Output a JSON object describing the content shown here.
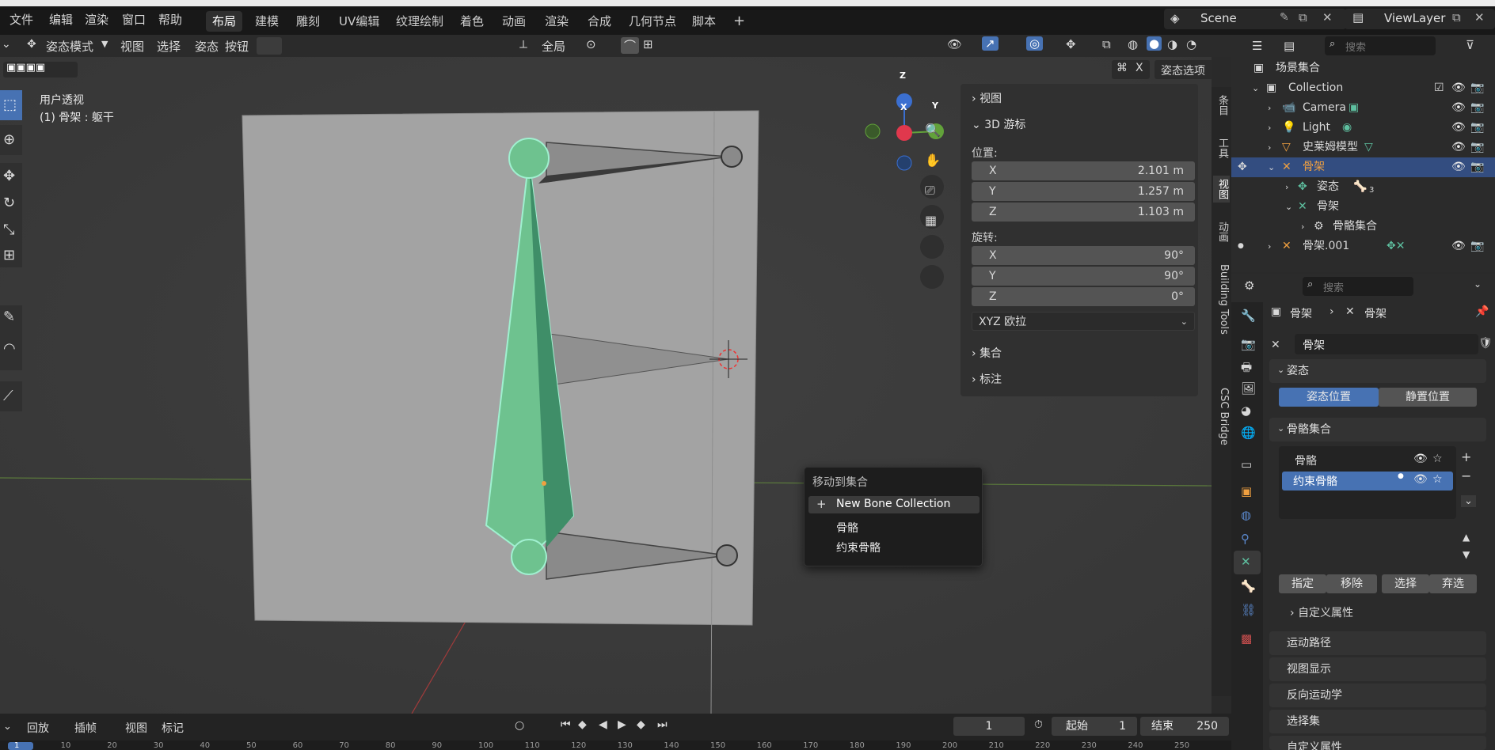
{
  "menubar": {
    "items": [
      "文件",
      "编辑",
      "渲染",
      "窗口",
      "帮助"
    ],
    "workspaces": [
      "布局",
      "建模",
      "雕刻",
      "UV编辑",
      "纹理绘制",
      "着色",
      "动画",
      "渲染",
      "合成",
      "几何节点",
      "脚本"
    ],
    "active_workspace": "布局",
    "add_tab": "+",
    "scene_name": "Scene",
    "viewlayer_name": "ViewLayer"
  },
  "viewport_header": {
    "mode": "姿态模式",
    "menus": [
      "视图",
      "选择",
      "姿态",
      "按钮"
    ],
    "transform_orientation": "全局",
    "pose_options": "姿态选项",
    "x_label": "X"
  },
  "viewport": {
    "view_name": "用户透视",
    "object_info": "(1) 骨架 : 躯干",
    "gizmo": {
      "x": "X",
      "y": "Y",
      "z": "Z"
    }
  },
  "npanel": {
    "view_section": "视图",
    "cursor_section": "3D 游标",
    "location_label": "位置:",
    "location": [
      {
        "axis": "X",
        "value": "2.101 m"
      },
      {
        "axis": "Y",
        "value": "1.257 m"
      },
      {
        "axis": "Z",
        "value": "1.103 m"
      }
    ],
    "rotation_label": "旋转:",
    "rotation": [
      {
        "axis": "X",
        "value": "90°"
      },
      {
        "axis": "Y",
        "value": "90°"
      },
      {
        "axis": "Z",
        "value": "0°"
      }
    ],
    "rotation_mode": "XYZ 欧拉",
    "collection_section": "集合",
    "annotation_section": "标注"
  },
  "sidebar_tabs": [
    "条目",
    "工具",
    "视图",
    "动画",
    "Building Tools",
    "CSC Bridge"
  ],
  "context_menu": {
    "title": "移动到集合",
    "new_item": "New Bone Collection",
    "items": [
      "骨骼",
      "约束骨骼"
    ]
  },
  "outliner": {
    "search_placeholder": "搜索",
    "rows": [
      {
        "label": "场景集合"
      },
      {
        "label": "Collection"
      },
      {
        "label": "Camera"
      },
      {
        "label": "Light"
      },
      {
        "label": "史莱姆模型"
      },
      {
        "label": "骨架"
      },
      {
        "label": "姿态"
      },
      {
        "label": "骨架"
      },
      {
        "label": "骨骼集合"
      },
      {
        "label": "骨架.001"
      }
    ],
    "pose_badge": "3"
  },
  "properties": {
    "search_placeholder": "搜索",
    "breadcrumb": [
      "骨架",
      "骨架"
    ],
    "data_name": "骨架",
    "pose_section": "姿态",
    "pose_position": "姿态位置",
    "rest_position": "静置位置",
    "bone_collections_section": "骨骼集合",
    "collections": [
      "骨骼",
      "约束骨骼"
    ],
    "assign": "指定",
    "remove": "移除",
    "select": "选择",
    "deselect": "弃选",
    "custom_props": "自定义属性",
    "motion_paths": "运动路径",
    "viewport_display": "视图显示",
    "inverse_kinematics": "反向运动学",
    "selection_sets": "选择集",
    "custom_props2": "自定义属性"
  },
  "timeline": {
    "menus": [
      "回放",
      "插帧",
      "视图",
      "标记"
    ],
    "current_frame": "1",
    "start_label": "起始",
    "start": "1",
    "end_label": "结束",
    "end": "250",
    "ruler": [
      "1",
      "10",
      "20",
      "30",
      "40",
      "50",
      "60",
      "70",
      "80",
      "90",
      "100",
      "110",
      "120",
      "130",
      "140",
      "150",
      "160",
      "170",
      "180",
      "190",
      "200",
      "210",
      "220",
      "230",
      "240",
      "250"
    ]
  },
  "colors": {
    "accent": "#4772b3",
    "bone": "#6ec28f",
    "bone_stroke": "#a0f0d0",
    "selected_orange": "#f0a040"
  }
}
